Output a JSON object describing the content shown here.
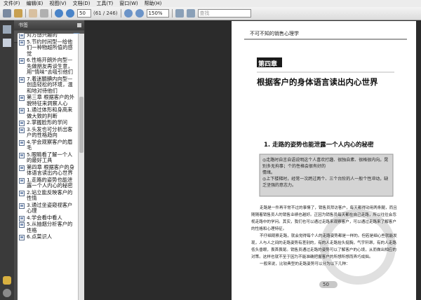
{
  "menu": {
    "file": "文件(F)",
    "edit": "编辑(E)",
    "view": "视图(V)",
    "document": "文档(D)",
    "tools": "工具(T)",
    "window": "窗口(W)",
    "help": "帮助(H)"
  },
  "toolbar": {
    "page_number": "50",
    "page_count": "(61 / 246)",
    "zoom": "150%",
    "search_placeholder": "查找"
  },
  "panel": {
    "title": "书签"
  },
  "bookmarks": [
    "对方感兴趣的",
    "5.节约时间型—给他们一种物超所值的感觉",
    "6.性格开朗外向型—先做朋友再谈生意，用“情味”去吸引他们",
    "7.着迷腼腆内向型—创造轻松的环境，温和地对待他们",
    "第三章 根据客户的外貌特征来洞察人心",
    "1.通过体形和身高来做大致的判断",
    "2.掌握脸形的学问",
    "3.头发也可分析出客户的性格趋向",
    "4.学会观察客户的眉毛",
    "5.眼睛看了解一个人的最好工具",
    "第四章 根据客户的身体语言读出内心世界",
    "1.走路的姿势也能泄露一个人内心的秘密",
    "2.站立能反映客户的性情",
    "3.通过坐姿窥视客户心理",
    "4.学会看中看人",
    "5.从抽烟分析客户的性格",
    "6.点菜识人"
  ],
  "page": {
    "header": "不可不知的销售心理学",
    "chapter_label": "第四章",
    "chapter_title": "根据客户的身体语言读出内心世界",
    "section_title": "1. 走路的姿势也能泄露一个人内心的秘密",
    "box_lines": [
      "◎走路时自言自语说明这个人喜欢打趣、很独自素、很格很内向。晃别多无拘事；个的性格会很有好的",
      "情绪。",
      "◎上下楼梯时，经常一次跨过两个、三个台阶的人一般个性冲动，缺乏坚强的意志力。"
    ],
    "paragraphs": [
      "走路是一件再平常不过的事情了，销售员拜访客户，每天都得动用两条腿，而且随随着销售员人的销售业绩也越好。正因为销售员每天都在自己走路，所以往往会忽视走路中的学问。其实，我们也可以通过走路来观察客户，可以通过走路来了解客户的性格和心理特征。",
      "不仔细观察走路，就会觉得每个人的走路姿势都是一样的。但若是细心些就能发现，人与人之间的走路姿势有差别的，有的人走路抬头挺胸，气宇轩昂，有的人走路低头垂眼，畏首畏尾。销售员通过走路的姿势可以了解客户的心境，从而做出相应的对策。这样也就不至于因为不能准确把握客户的所想所想而弄巧成拙。",
      "一般来说，比较典型的走路姿势可以分为以下几种："
    ],
    "page_number": "50"
  }
}
